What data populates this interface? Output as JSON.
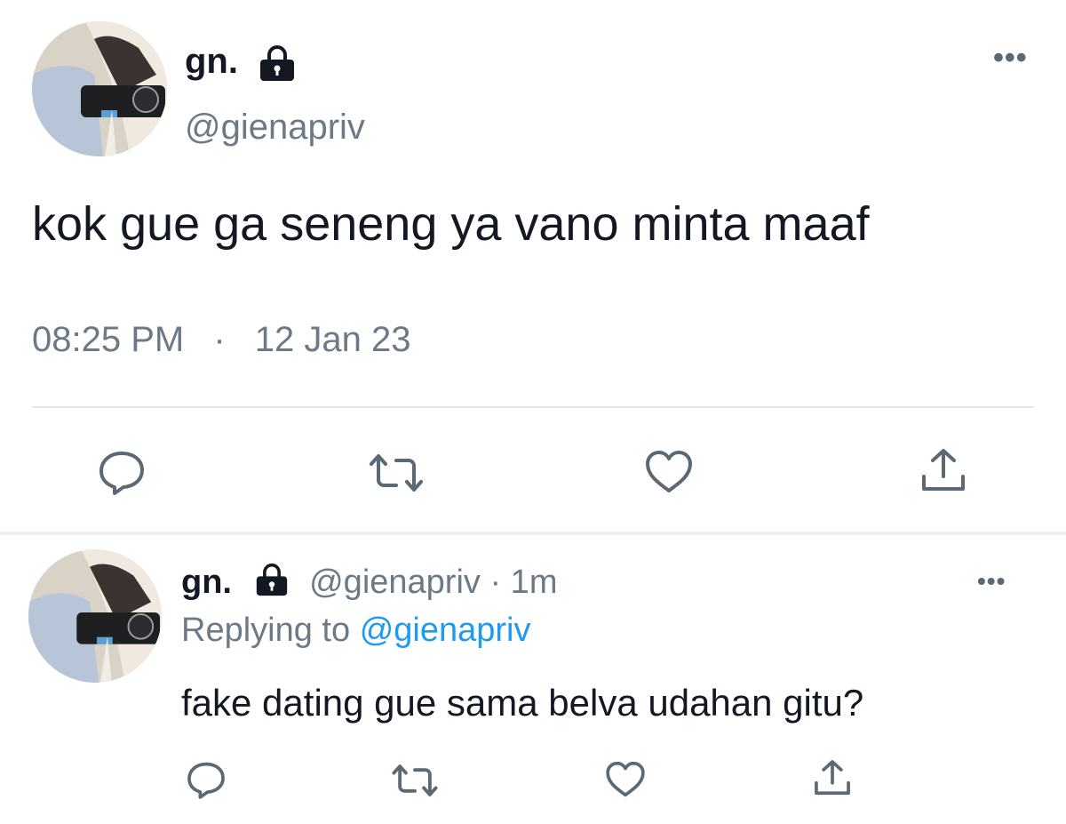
{
  "main_tweet": {
    "display_name": "gn.",
    "handle": "@gienapriv",
    "text": "kok gue ga seneng ya vano minta maaf",
    "time": "08:25 PM",
    "separator": "·",
    "date": "12 Jan 23",
    "icons": [
      "lock-icon",
      "more-icon",
      "reply-icon",
      "retweet-icon",
      "like-icon",
      "share-icon"
    ]
  },
  "reply_tweet": {
    "display_name": "gn.",
    "handle": "@gienapriv",
    "age": "· 1m",
    "replying_prefix": "Replying to",
    "replying_handle": "@gienapriv",
    "text": "fake dating gue sama belva udahan gitu?",
    "icons": [
      "lock-icon",
      "more-icon",
      "reply-icon",
      "retweet-icon",
      "like-icon",
      "share-icon"
    ]
  },
  "colors": {
    "text": "#141823",
    "muted": "#6b7a86",
    "link": "#1d9bf0",
    "icon": "#5b6975",
    "divider": "#e3e7ea"
  }
}
